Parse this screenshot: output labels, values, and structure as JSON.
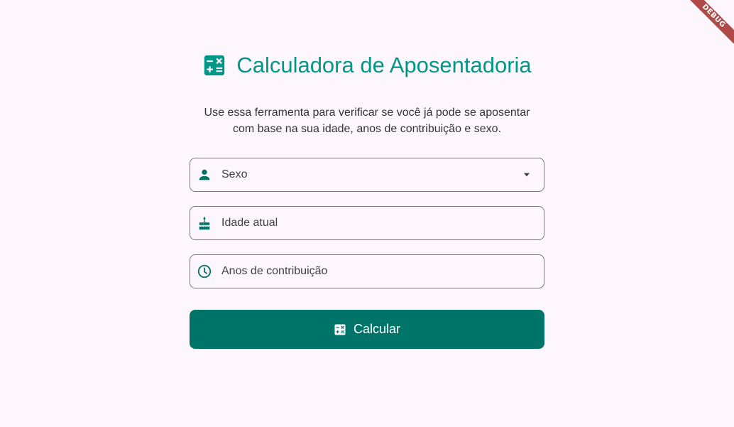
{
  "debug_banner": "DEBUG",
  "header": {
    "title": "Calculadora de Aposentadoria",
    "icon": "calculate-icon",
    "color": "#009688"
  },
  "description": {
    "line1": "Use essa ferramenta para verificar se você já pode se aposentar",
    "line2": "com base na sua idade, anos de contribuição e sexo."
  },
  "form": {
    "sex": {
      "label": "Sexo",
      "icon": "person-icon",
      "dropdown_icon": "arrow-drop-down-icon"
    },
    "age": {
      "label": "Idade atual",
      "icon": "cake-icon"
    },
    "contribution": {
      "label": "Anos de contribuição",
      "icon": "clock-icon"
    }
  },
  "calculate_button": {
    "label": "Calcular",
    "icon": "calculate-icon",
    "color": "#007468"
  }
}
